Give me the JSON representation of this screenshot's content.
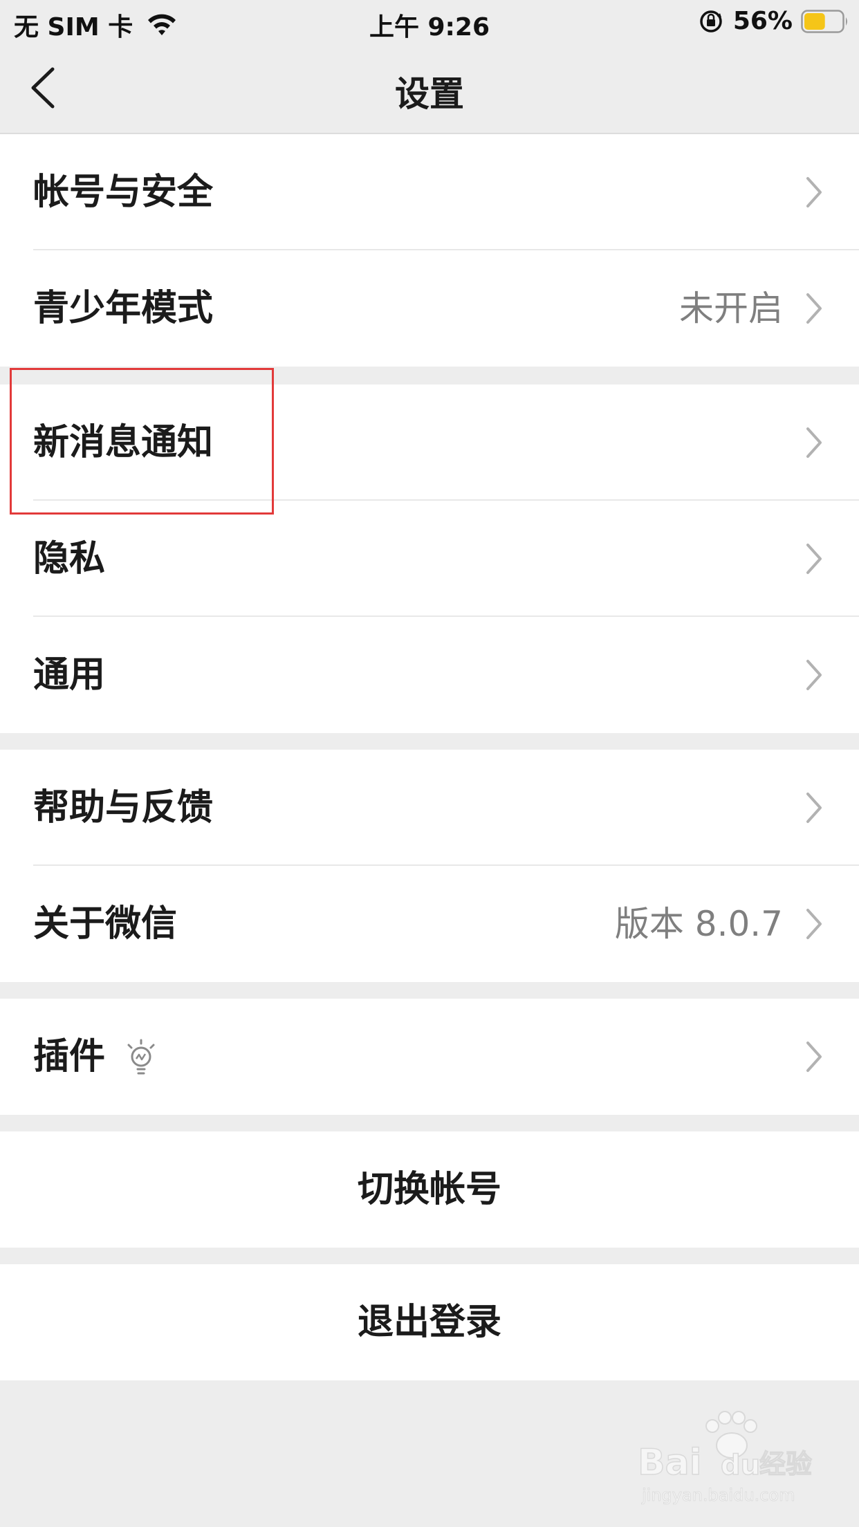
{
  "status_bar": {
    "carrier": "无 SIM 卡",
    "time": "上午 9:26",
    "battery_percent": "56%",
    "battery_level": 0.56,
    "battery_color": "#f5c518"
  },
  "nav": {
    "title": "设置",
    "back_icon": "chevron-left-icon"
  },
  "settings": {
    "group1": [
      {
        "label": "帐号与安全",
        "value": ""
      },
      {
        "label": "青少年模式",
        "value": "未开启"
      }
    ],
    "group2": [
      {
        "label": "新消息通知",
        "value": ""
      },
      {
        "label": "隐私",
        "value": ""
      },
      {
        "label": "通用",
        "value": ""
      }
    ],
    "group3": [
      {
        "label": "帮助与反馈",
        "value": ""
      },
      {
        "label": "关于微信",
        "value": "版本 8.0.7"
      }
    ],
    "group4": [
      {
        "label": "插件",
        "value": "",
        "icon": "lightbulb-icon"
      }
    ]
  },
  "actions": {
    "switch_account": "切换帐号",
    "logout": "退出登录"
  },
  "colors": {
    "background": "#ededed",
    "cell": "#ffffff",
    "highlight": "#e23a3a"
  },
  "watermark": {
    "brand": "Baidu经验",
    "url": "jingyan.baidu.com"
  }
}
